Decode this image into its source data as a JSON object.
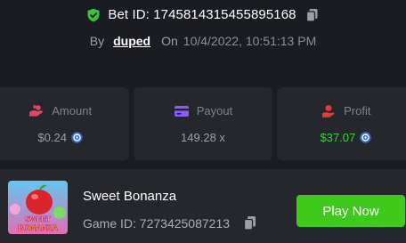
{
  "bet": {
    "id_label": "Bet ID: 1745814315455895168",
    "by_label": "By",
    "user": "duped",
    "on_label": "On",
    "date": "10/4/2022, 10:51:13 PM"
  },
  "stats": [
    {
      "label": "Amount",
      "value": "$0.24",
      "value_color": "#9aa0a6",
      "icon_color": "#e0465f"
    },
    {
      "label": "Payout",
      "value": "149.28 x",
      "value_color": "#9aa0a6",
      "icon_color": "#8b5cf6"
    },
    {
      "label": "Profit",
      "value": "$37.07",
      "value_color": "#3ed03e",
      "icon_color": "#e23b3b"
    }
  ],
  "game": {
    "name": "Sweet Bonanza",
    "id_label": "Game ID: 7273425087213",
    "play_label": "Play Now",
    "thumb_text_1": "SWEET",
    "thumb_text_2": "BONANZA"
  },
  "colors": {
    "accent": "#40c91d",
    "background": "#1a1c21",
    "card": "#25272d"
  }
}
